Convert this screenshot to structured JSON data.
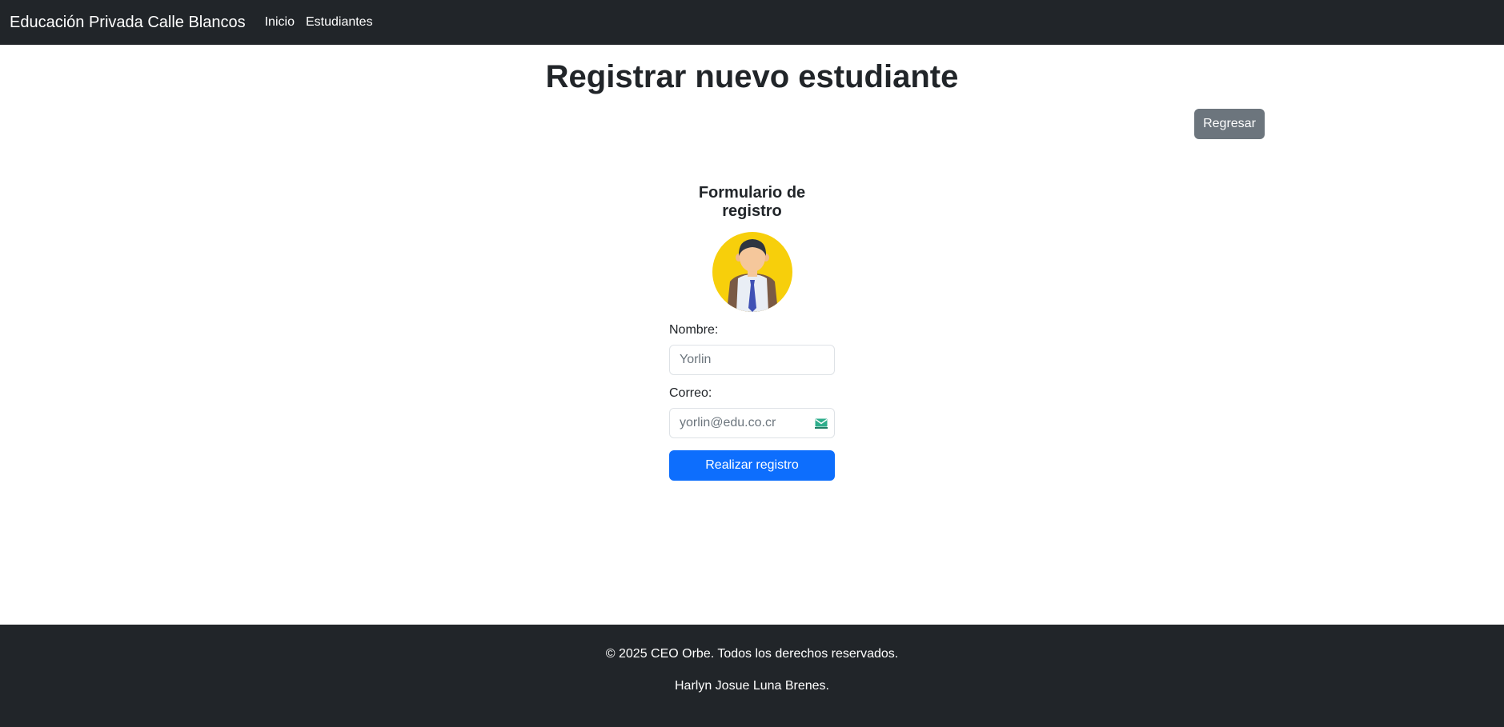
{
  "navbar": {
    "brand": "Educación Privada Calle Blancos",
    "links": [
      "Inicio",
      "Estudiantes"
    ]
  },
  "page": {
    "title": "Registrar nuevo estudiante",
    "back_label": "Regresar"
  },
  "form": {
    "title": "Formulario de registro",
    "avatar_icon": "student-avatar-icon",
    "name_label": "Nombre:",
    "name_placeholder": "Yorlin",
    "email_label": "Correo:",
    "email_placeholder": "yorlin@edu.co.cr",
    "email_icon": "mail-icon",
    "submit_label": "Realizar registro"
  },
  "footer": {
    "copyright": "© 2025 CEO Orbe. Todos los derechos reservados.",
    "author": "Harlyn Josue Luna Brenes."
  },
  "colors": {
    "navbar_bg": "#212529",
    "primary": "#0d6efd",
    "secondary": "#6c757d",
    "avatar_bg": "#f7cf0b"
  }
}
